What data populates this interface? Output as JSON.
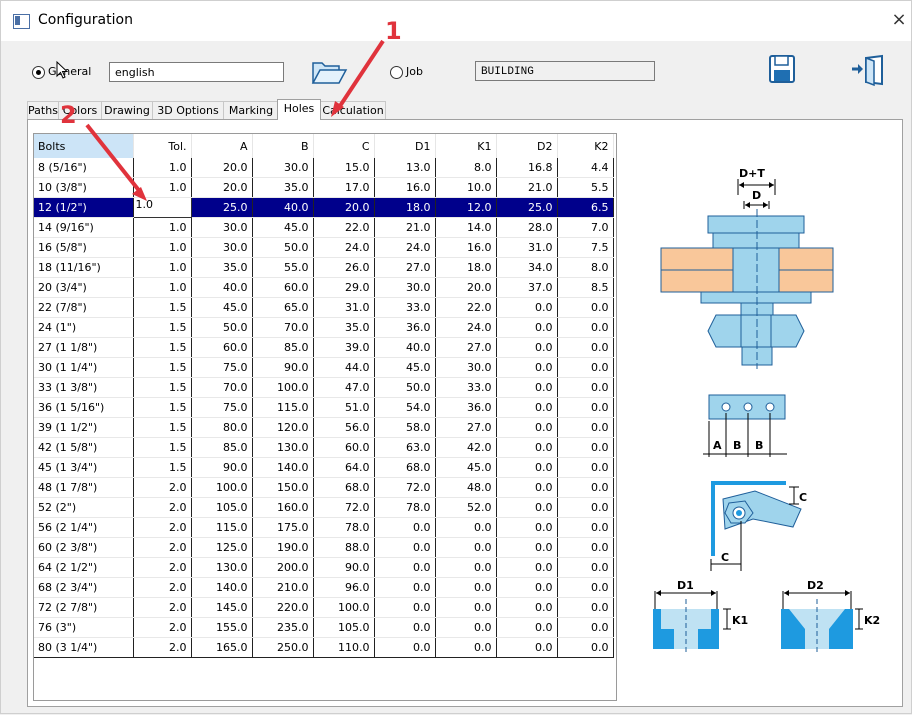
{
  "window": {
    "title": "Configuration",
    "close_glyph": "×"
  },
  "scope": {
    "general_label": "General",
    "general_checked": true,
    "language_value": "english",
    "job_label": "Job",
    "job_checked": false,
    "job_value": "BUILDING"
  },
  "tabs": [
    {
      "label": "Paths",
      "active": false
    },
    {
      "label": "Colors",
      "active": false
    },
    {
      "label": "Drawing",
      "active": false
    },
    {
      "label": "3D Options",
      "active": false
    },
    {
      "label": "Marking",
      "active": false
    },
    {
      "label": "Holes",
      "active": true
    },
    {
      "label": "Calculation",
      "active": false
    }
  ],
  "table": {
    "columns": [
      "Bolts",
      "Tol.",
      "A",
      "B",
      "C",
      "D1",
      "K1",
      "D2",
      "K2"
    ],
    "selected_row": 2,
    "editing_value": "1.0",
    "rows": [
      [
        "8 (5/16\")",
        "1.0",
        "20.0",
        "30.0",
        "15.0",
        "13.0",
        "8.0",
        "16.8",
        "4.4"
      ],
      [
        "10 (3/8\")",
        "1.0",
        "20.0",
        "35.0",
        "17.0",
        "16.0",
        "10.0",
        "21.0",
        "5.5"
      ],
      [
        "12 (1/2\")",
        "",
        "25.0",
        "40.0",
        "20.0",
        "18.0",
        "12.0",
        "25.0",
        "6.5"
      ],
      [
        "14 (9/16\")",
        "1.0",
        "30.0",
        "45.0",
        "22.0",
        "21.0",
        "14.0",
        "28.0",
        "7.0"
      ],
      [
        "16 (5/8\")",
        "1.0",
        "30.0",
        "50.0",
        "24.0",
        "24.0",
        "16.0",
        "31.0",
        "7.5"
      ],
      [
        "18 (11/16\")",
        "1.0",
        "35.0",
        "55.0",
        "26.0",
        "27.0",
        "18.0",
        "34.0",
        "8.0"
      ],
      [
        "20 (3/4\")",
        "1.0",
        "40.0",
        "60.0",
        "29.0",
        "30.0",
        "20.0",
        "37.0",
        "8.5"
      ],
      [
        "22 (7/8\")",
        "1.5",
        "45.0",
        "65.0",
        "31.0",
        "33.0",
        "22.0",
        "0.0",
        "0.0"
      ],
      [
        "24 (1\")",
        "1.5",
        "50.0",
        "70.0",
        "35.0",
        "36.0",
        "24.0",
        "0.0",
        "0.0"
      ],
      [
        "27 (1 1/8\")",
        "1.5",
        "60.0",
        "85.0",
        "39.0",
        "40.0",
        "27.0",
        "0.0",
        "0.0"
      ],
      [
        "30 (1 1/4\")",
        "1.5",
        "75.0",
        "90.0",
        "44.0",
        "45.0",
        "30.0",
        "0.0",
        "0.0"
      ],
      [
        "33 (1 3/8\")",
        "1.5",
        "70.0",
        "100.0",
        "47.0",
        "50.0",
        "33.0",
        "0.0",
        "0.0"
      ],
      [
        "36 (1 5/16\")",
        "1.5",
        "75.0",
        "115.0",
        "51.0",
        "54.0",
        "36.0",
        "0.0",
        "0.0"
      ],
      [
        "39 (1 1/2\")",
        "1.5",
        "80.0",
        "120.0",
        "56.0",
        "58.0",
        "27.0",
        "0.0",
        "0.0"
      ],
      [
        "42 (1 5/8\")",
        "1.5",
        "85.0",
        "130.0",
        "60.0",
        "63.0",
        "42.0",
        "0.0",
        "0.0"
      ],
      [
        "45 (1 3/4\")",
        "1.5",
        "90.0",
        "140.0",
        "64.0",
        "68.0",
        "45.0",
        "0.0",
        "0.0"
      ],
      [
        "48 (1 7/8\")",
        "2.0",
        "100.0",
        "150.0",
        "68.0",
        "72.0",
        "48.0",
        "0.0",
        "0.0"
      ],
      [
        "52 (2\")",
        "2.0",
        "105.0",
        "160.0",
        "72.0",
        "78.0",
        "52.0",
        "0.0",
        "0.0"
      ],
      [
        "56 (2 1/4\")",
        "2.0",
        "115.0",
        "175.0",
        "78.0",
        "0.0",
        "0.0",
        "0.0",
        "0.0"
      ],
      [
        "60 (2 3/8\")",
        "2.0",
        "125.0",
        "190.0",
        "88.0",
        "0.0",
        "0.0",
        "0.0",
        "0.0"
      ],
      [
        "64 (2 1/2\")",
        "2.0",
        "130.0",
        "200.0",
        "90.0",
        "0.0",
        "0.0",
        "0.0",
        "0.0"
      ],
      [
        "68 (2 3/4\")",
        "2.0",
        "140.0",
        "210.0",
        "96.0",
        "0.0",
        "0.0",
        "0.0",
        "0.0"
      ],
      [
        "72 (2 7/8\")",
        "2.0",
        "145.0",
        "220.0",
        "100.0",
        "0.0",
        "0.0",
        "0.0",
        "0.0"
      ],
      [
        "76 (3\")",
        "2.0",
        "155.0",
        "235.0",
        "105.0",
        "0.0",
        "0.0",
        "0.0",
        "0.0"
      ],
      [
        "80 (3 1/4\")",
        "2.0",
        "165.0",
        "250.0",
        "110.0",
        "0.0",
        "0.0",
        "0.0",
        "0.0"
      ]
    ]
  },
  "diagram_labels": {
    "d_plus_t": "D+T",
    "d": "D",
    "a": "A",
    "b": "B",
    "c": "C",
    "d1": "D1",
    "k1": "K1",
    "d2": "D2",
    "k2": "K2"
  },
  "annotations": {
    "one": "1",
    "two": "2"
  },
  "icons": {
    "folder": "folder-open-icon",
    "save": "floppy-save-icon",
    "exit": "door-exit-icon",
    "cursor": "mouse-pointer-icon"
  },
  "colors": {
    "selection": "#00008b",
    "bolt_blue": "#9fd4ec",
    "plate_orange": "#f9c79a",
    "hole_blue": "#1e9ae0",
    "annotation_red": "#e0333c",
    "header_highlight": "#cce4f7"
  }
}
